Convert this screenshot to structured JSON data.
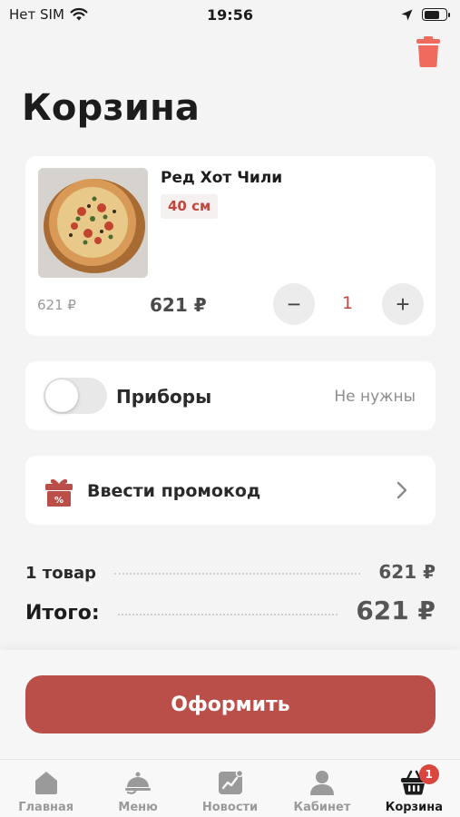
{
  "status_bar": {
    "carrier": "Нет SIM",
    "time": "19:56"
  },
  "header": {
    "title": "Корзина"
  },
  "cart_item": {
    "name": "Ред Хот Чили",
    "size": "40 см",
    "old_price": "621 ₽",
    "price": "621 ₽",
    "quantity": "1",
    "minus": "−",
    "plus": "+"
  },
  "cutlery": {
    "label": "Приборы",
    "value": "Не нужны"
  },
  "promo": {
    "label": "Ввести промокод"
  },
  "summary": {
    "count_label": "1 товар",
    "count_value": "621 ₽",
    "total_label": "Итого:",
    "total_value": "621 ₽"
  },
  "checkout": {
    "label": "Оформить"
  },
  "tabs": [
    {
      "label": "Главная",
      "icon": "home-icon"
    },
    {
      "label": "Меню",
      "icon": "cloche-icon"
    },
    {
      "label": "Новости",
      "icon": "news-icon"
    },
    {
      "label": "Кабинет",
      "icon": "user-icon"
    },
    {
      "label": "Корзина",
      "icon": "basket-icon",
      "badge": "1",
      "active": true
    }
  ],
  "colors": {
    "accent": "#b94f48",
    "trash": "#f06a5e",
    "badge": "#d9463e"
  }
}
